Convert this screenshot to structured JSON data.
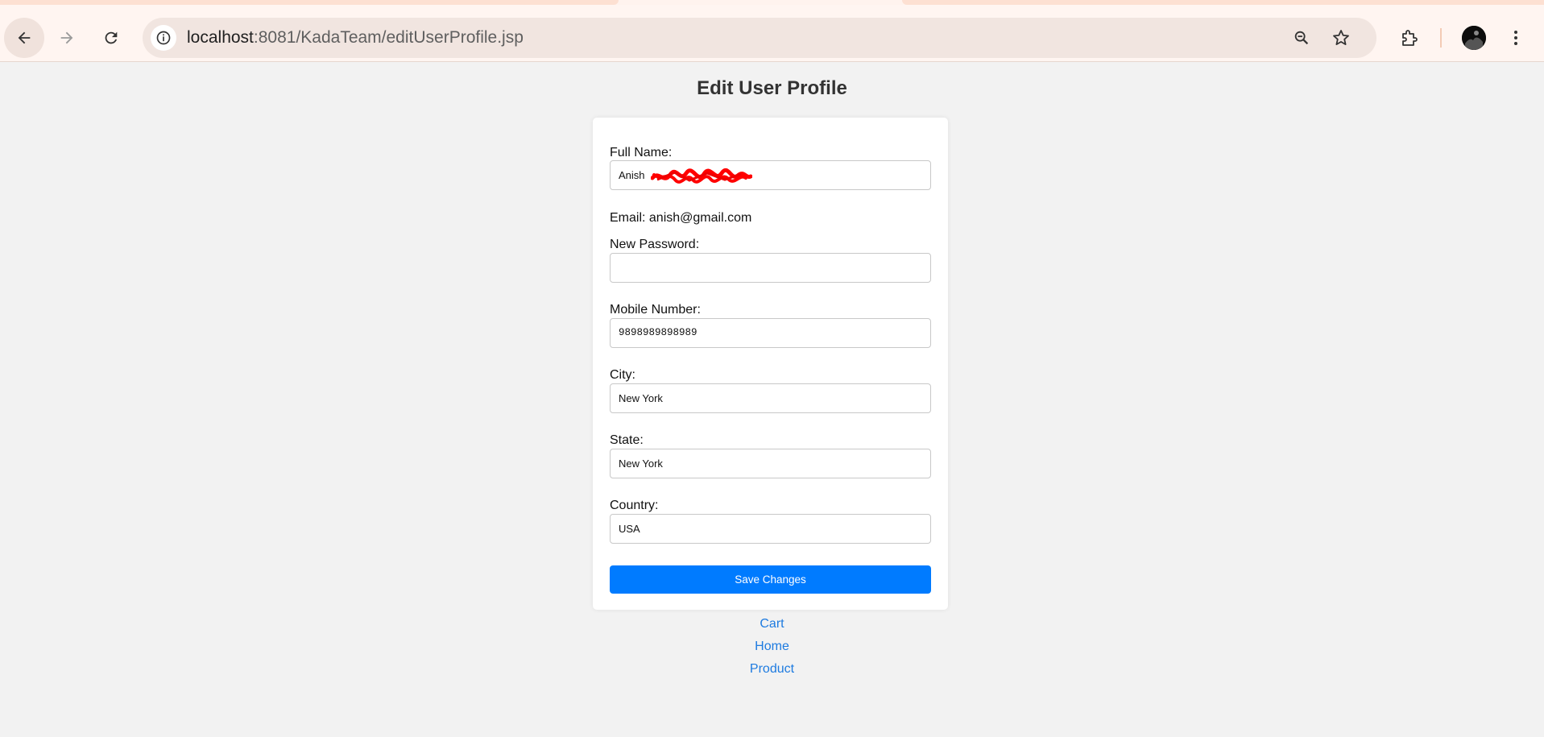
{
  "browser": {
    "url_host": "localhost",
    "url_path": ":8081/KadaTeam/editUserProfile.jsp"
  },
  "page": {
    "title": "Edit User Profile"
  },
  "form": {
    "full_name_label": "Full Name:",
    "full_name_value": "Anish",
    "email_label": "Email:",
    "email_value": "anish@gmail.com",
    "password_label": "New Password:",
    "password_value": "",
    "mobile_label": "Mobile Number:",
    "mobile_value": "9898989898989",
    "city_label": "City:",
    "city_value": "New York",
    "state_label": "State:",
    "state_value": "New York",
    "country_label": "Country:",
    "country_value": "USA",
    "save_label": "Save Changes"
  },
  "links": {
    "cart": "Cart",
    "home": "Home",
    "product": "Product"
  },
  "colors": {
    "accent": "#007bff",
    "link": "#1e7be0",
    "redaction": "#ff0000"
  }
}
